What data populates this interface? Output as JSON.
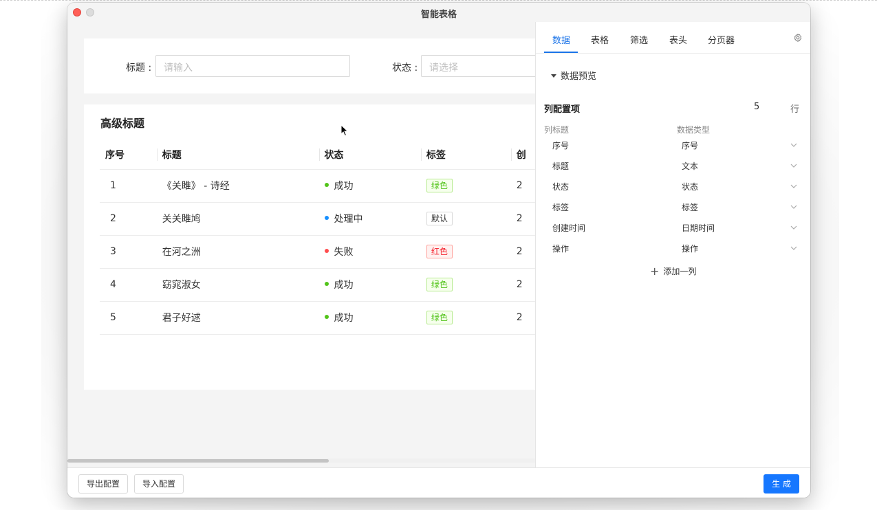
{
  "window": {
    "title": "智能表格"
  },
  "filters": {
    "title_label": "标题 :",
    "title_placeholder": "请输入",
    "status_label": "状态 :",
    "status_placeholder": "请选择"
  },
  "table": {
    "card_title": "高级标题",
    "columns": [
      "序号",
      "标题",
      "状态",
      "标签",
      "创"
    ],
    "rows": [
      {
        "index": "1",
        "title": "《关雎》 - 诗经",
        "status": "成功",
        "status_color": "#52c41a",
        "tag": "绿色",
        "tag_color": "#52c41a",
        "tag_bg": "#f6ffed",
        "tag_border": "#b7eb8f",
        "created": "2"
      },
      {
        "index": "2",
        "title": "关关雎鸠",
        "status": "处理中",
        "status_color": "#1890ff",
        "tag": "默认",
        "tag_color": "#333333",
        "tag_bg": "#ffffff",
        "tag_border": "#d9d9d9",
        "created": "2"
      },
      {
        "index": "3",
        "title": "在河之洲",
        "status": "失败",
        "status_color": "#ff4d4f",
        "tag": "红色",
        "tag_color": "#f5222d",
        "tag_bg": "#fff1f0",
        "tag_border": "#ffa39e",
        "created": "2"
      },
      {
        "index": "4",
        "title": "窈窕淑女",
        "status": "成功",
        "status_color": "#52c41a",
        "tag": "绿色",
        "tag_color": "#52c41a",
        "tag_bg": "#f6ffed",
        "tag_border": "#b7eb8f",
        "created": "2"
      },
      {
        "index": "5",
        "title": "君子好逑",
        "status": "成功",
        "status_color": "#52c41a",
        "tag": "绿色",
        "tag_color": "#52c41a",
        "tag_bg": "#f6ffed",
        "tag_border": "#b7eb8f",
        "created": "2"
      }
    ]
  },
  "panel": {
    "tabs": [
      "数据",
      "表格",
      "筛选",
      "表头",
      "分页器"
    ],
    "active_tab": "数据",
    "preview_label": "数据预览",
    "config_title": "列配置项",
    "config_count": "5",
    "config_unit": "行",
    "col_header_title": "列标题",
    "col_header_type": "数据类型",
    "columns": [
      {
        "name": "序号",
        "type": "序号"
      },
      {
        "name": "标题",
        "type": "文本"
      },
      {
        "name": "状态",
        "type": "状态"
      },
      {
        "name": "标签",
        "type": "标签"
      },
      {
        "name": "创建时间",
        "type": "日期时间"
      },
      {
        "name": "操作",
        "type": "操作"
      }
    ],
    "add_column_label": "添加一列"
  },
  "footer": {
    "export_label": "导出配置",
    "import_label": "导入配置",
    "generate_label": "生 成"
  },
  "colors": {
    "accent": "#1677ff"
  }
}
